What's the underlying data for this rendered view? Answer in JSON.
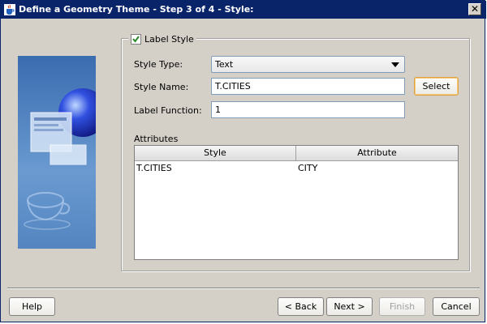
{
  "window": {
    "title": "Define a Geometry Theme - Step 3 of 4 - Style:",
    "close_label": "✕"
  },
  "group": {
    "checkbox_label": "Label Style",
    "checked": true
  },
  "form": {
    "style_type_label": "Style Type:",
    "style_type_value": "Text",
    "style_name_label": "Style Name:",
    "style_name_value": "T.CITIES",
    "select_button_label": "Select",
    "label_function_label": "Label Function:",
    "label_function_value": "1"
  },
  "attributes": {
    "label": "Attributes",
    "columns": [
      "Style",
      "Attribute"
    ],
    "rows": [
      [
        "T.CITIES",
        "CITY"
      ]
    ]
  },
  "footer": {
    "help_label": "Help",
    "back_label": "< Back",
    "next_label": "Next >",
    "finish_label": "Finish",
    "cancel_label": "Cancel"
  },
  "icons": {
    "title_icon": "java-cup-icon",
    "close_icon": "close-icon",
    "check_icon": "checkmark-icon",
    "dropdown_icon": "triangle-down-icon"
  },
  "colors": {
    "titlebar": "#0a246a",
    "dialog_bg": "#d4d0c8",
    "select_highlight": "#e0a040"
  }
}
